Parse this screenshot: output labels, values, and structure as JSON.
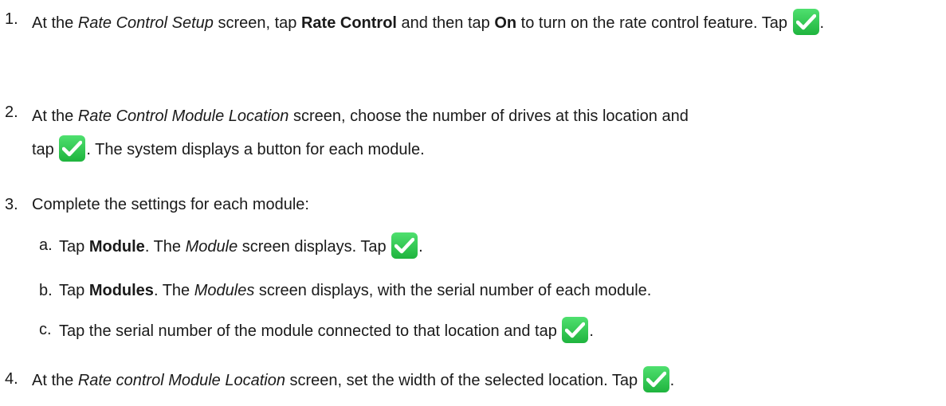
{
  "steps": [
    {
      "num": "1.",
      "pre": "At the ",
      "screen": "Rate Control Setup",
      "mid1": " screen, tap ",
      "bold1": "Rate Control",
      "mid2": " and then tap ",
      "bold2": "On",
      "post": " to turn on the rate control feature. Tap ",
      "end": "."
    },
    {
      "num": "2.",
      "pre": "At the ",
      "screen": "Rate Control Module Location",
      "line1_post": " screen, choose the number of drives at this location and",
      "line2_pre": "tap ",
      "line2_post": ". The system displays a button for each module."
    },
    {
      "num": "3.",
      "text": "Complete the settings for each module:"
    },
    {
      "num": "4.",
      "pre": "At the ",
      "screen": "Rate control Module Location",
      "post": " screen, set the width of the selected location. Tap ",
      "end": "."
    }
  ],
  "substeps": [
    {
      "num": "a.",
      "pre": "Tap ",
      "bold": "Module",
      "mid": ". The ",
      "screen": "Module",
      "post": " screen displays. Tap ",
      "end": "."
    },
    {
      "num": "b.",
      "pre": "Tap ",
      "bold": "Modules",
      "mid": ". The ",
      "screen": "Modules",
      "post": " screen displays, with the serial number of each module."
    },
    {
      "num": "c.",
      "text": "Tap the serial number of the module connected to that location and tap ",
      "end": "."
    }
  ],
  "icons": {
    "check": "checkmark-icon",
    "check_color": "#2cc84a"
  }
}
